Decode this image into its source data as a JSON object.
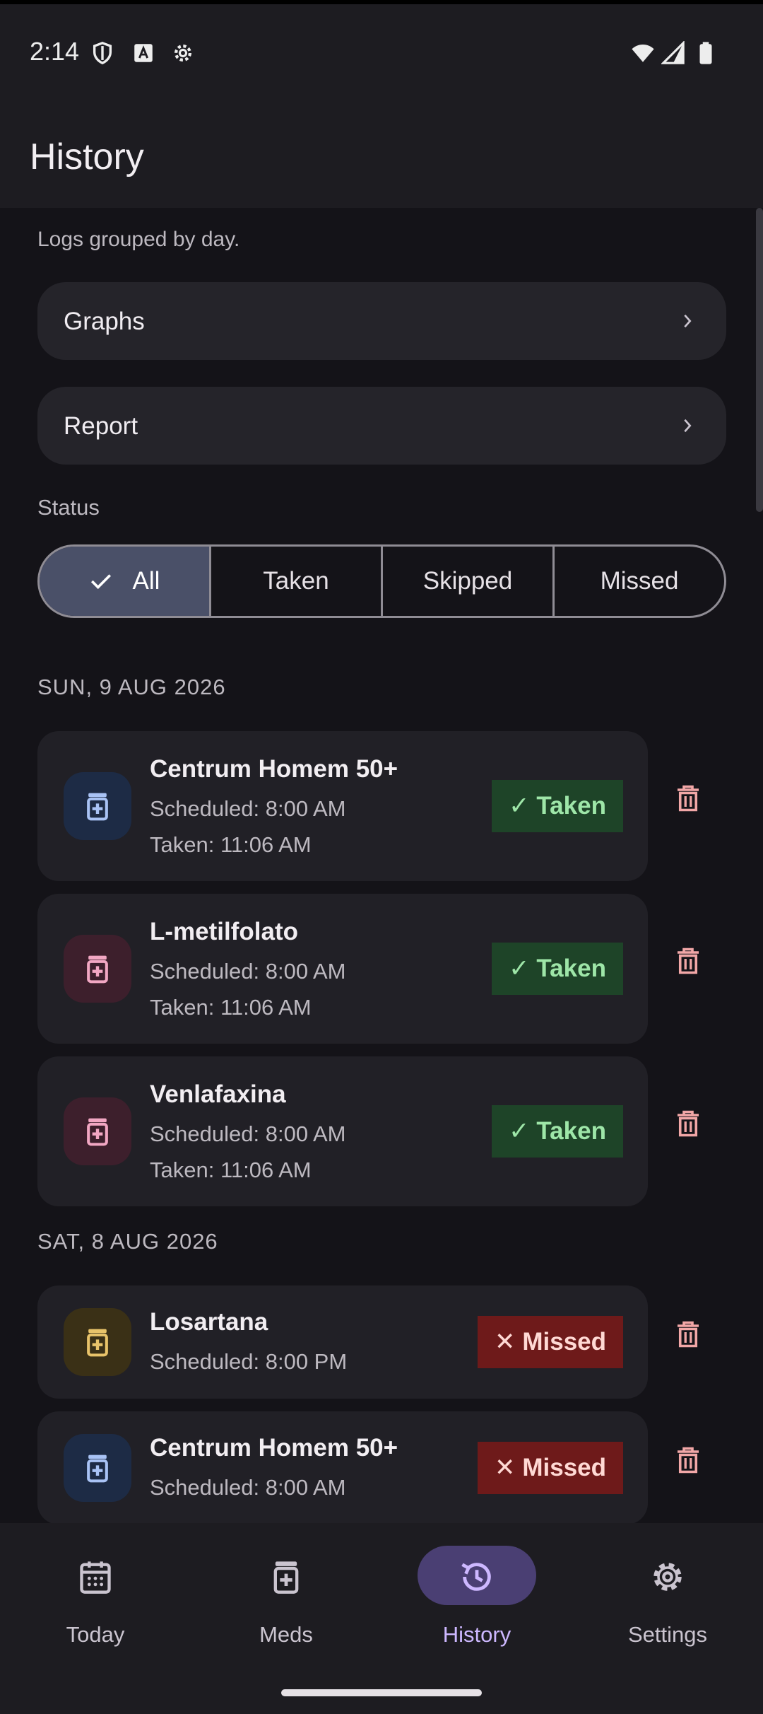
{
  "status_bar": {
    "time": "2:14"
  },
  "app_bar": {
    "title": "History"
  },
  "content": {
    "subtitle": "Logs grouped by day.",
    "nav_cards": [
      {
        "label": "Graphs"
      },
      {
        "label": "Report"
      }
    ],
    "status_label": "Status",
    "filters": [
      {
        "label": "All",
        "selected": true
      },
      {
        "label": "Taken",
        "selected": false
      },
      {
        "label": "Skipped",
        "selected": false
      },
      {
        "label": "Missed",
        "selected": false
      }
    ],
    "days": [
      {
        "label": "SUN, 9 AUG 2026",
        "logs": [
          {
            "name": "Centrum Homem 50+",
            "scheduled": "Scheduled: 8:00 AM",
            "taken": "Taken: 11:06 AM",
            "status": "Taken",
            "mark": "✓",
            "icon_color": "#1D2B45",
            "icon_fg": "#A9C3F5"
          },
          {
            "name": "L-metilfolato",
            "scheduled": "Scheduled: 8:00 AM",
            "taken": "Taken: 11:06 AM",
            "status": "Taken",
            "mark": "✓",
            "icon_color": "#3D1F2C",
            "icon_fg": "#F2A7C3"
          },
          {
            "name": "Venlafaxina",
            "scheduled": "Scheduled: 8:00 AM",
            "taken": "Taken: 11:06 AM",
            "status": "Taken",
            "mark": "✓",
            "icon_color": "#3D1F2C",
            "icon_fg": "#F2A7C3"
          }
        ]
      },
      {
        "label": "SAT, 8 AUG 2026",
        "logs": [
          {
            "name": "Losartana",
            "scheduled": "Scheduled: 8:00 PM",
            "status": "Missed",
            "mark": "✕",
            "icon_color": "#3A3016",
            "icon_fg": "#E8C36A"
          },
          {
            "name": "Centrum Homem 50+",
            "scheduled": "Scheduled: 8:00 AM",
            "status": "Missed",
            "mark": "✕",
            "icon_color": "#1D2B45",
            "icon_fg": "#A9C3F5"
          }
        ]
      }
    ]
  },
  "bottom_nav": {
    "items": [
      {
        "label": "Today",
        "icon": "calendar-icon",
        "active": false
      },
      {
        "label": "Meds",
        "icon": "pill-bottle-icon",
        "active": false
      },
      {
        "label": "History",
        "icon": "history-icon",
        "active": true
      },
      {
        "label": "Settings",
        "icon": "gear-icon",
        "active": false
      }
    ]
  },
  "colors": {
    "background": "#141318",
    "surface": "#1D1C21",
    "card": "#212026",
    "taken_bg": "#1E4428",
    "taken_fg": "#9EE6A8",
    "missed_bg": "#6E1A1A",
    "missed_fg": "#FFD9D4",
    "trash": "#F2A7A7",
    "accent": "#CDB8FF"
  }
}
